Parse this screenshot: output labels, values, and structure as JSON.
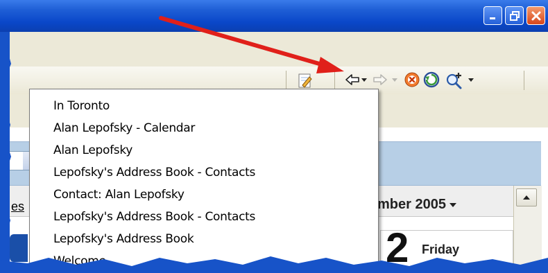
{
  "window": {
    "caption_buttons": [
      "minimize-icon",
      "restore-icon",
      "close-icon"
    ]
  },
  "toolbar": {
    "icons": [
      "edit-icon",
      "back-arrow-icon",
      "dropdown-arrow-icon",
      "forward-arrow-icon",
      "dropdown-arrow-icon",
      "stop-icon",
      "refresh-icon",
      "zoom-icon"
    ]
  },
  "history_menu": {
    "items": [
      "In Toronto",
      "Alan Lepofsky - Calendar",
      "Alan Lepofsky",
      "Lepofsky's Address Book - Contacts",
      "Contact: Alan Lepofsky",
      "Lepofsky's Address Book - Contacts",
      "Lepofsky's Address Book",
      "Welcome"
    ]
  },
  "calendar": {
    "link_text": "es",
    "month_title": "mber 2005",
    "day_number": "2",
    "day_name": "Friday"
  },
  "colors": {
    "titlebar": "#0a47c9",
    "annotation_arrow": "#e0201a",
    "band": "#b7cfe6"
  }
}
